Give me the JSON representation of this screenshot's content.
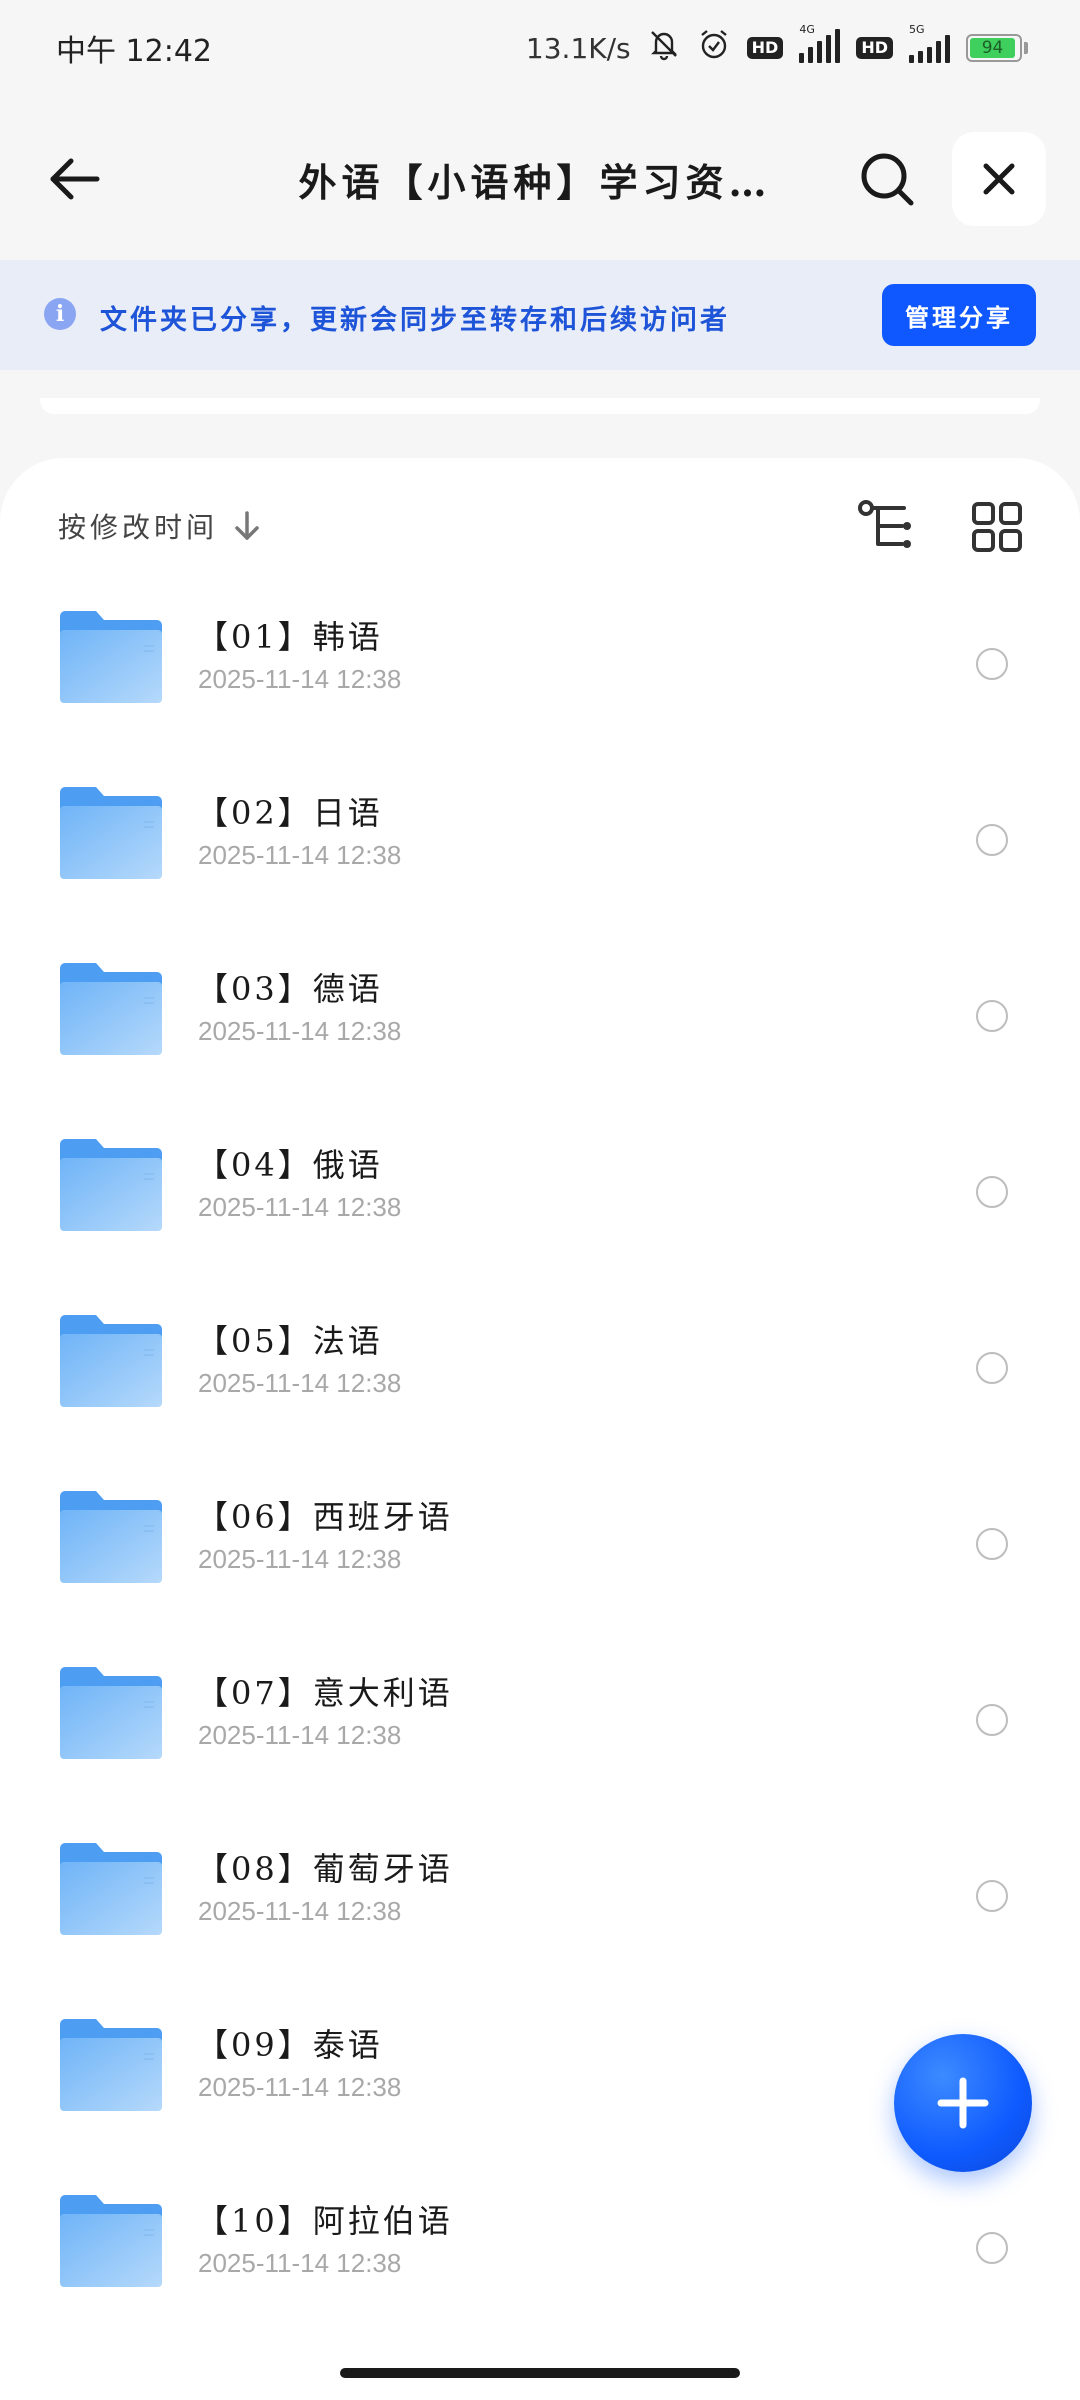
{
  "status_bar": {
    "time": "中午 12:42",
    "net_speed": "13.1K/s",
    "hd_label": "HD",
    "signal_4g": "4G",
    "signal_5g": "5G",
    "battery_level": "94",
    "icons": [
      "mute-bell-icon",
      "alarm-icon",
      "signal-icon",
      "battery-icon"
    ]
  },
  "nav": {
    "title": "外语【小语种】学习资…",
    "icons": [
      "back-arrow-icon",
      "search-icon",
      "close-icon"
    ]
  },
  "share_banner": {
    "message": "文件夹已分享，更新会同步至转存和后续访问者",
    "manage_button": "管理分享",
    "accent_color": "#0f57ff"
  },
  "toolbar": {
    "sort_label": "按修改时间",
    "icons": [
      "sort-down-arrow-icon",
      "tree-view-icon",
      "grid-view-icon"
    ]
  },
  "files": [
    {
      "name": "【01】韩语",
      "date": "2025-11-14  12:38"
    },
    {
      "name": "【02】日语",
      "date": "2025-11-14  12:38"
    },
    {
      "name": "【03】德语",
      "date": "2025-11-14  12:38"
    },
    {
      "name": "【04】俄语",
      "date": "2025-11-14  12:38"
    },
    {
      "name": "【05】法语",
      "date": "2025-11-14  12:38"
    },
    {
      "name": "【06】西班牙语",
      "date": "2025-11-14  12:38"
    },
    {
      "name": "【07】意大利语",
      "date": "2025-11-14  12:38"
    },
    {
      "name": "【08】葡萄牙语",
      "date": "2025-11-14  12:38"
    },
    {
      "name": "【09】泰语",
      "date": "2025-11-14  12:38"
    },
    {
      "name": "【10】阿拉伯语",
      "date": "2025-11-14  12:38"
    }
  ],
  "fab": {
    "icon": "plus-icon"
  }
}
